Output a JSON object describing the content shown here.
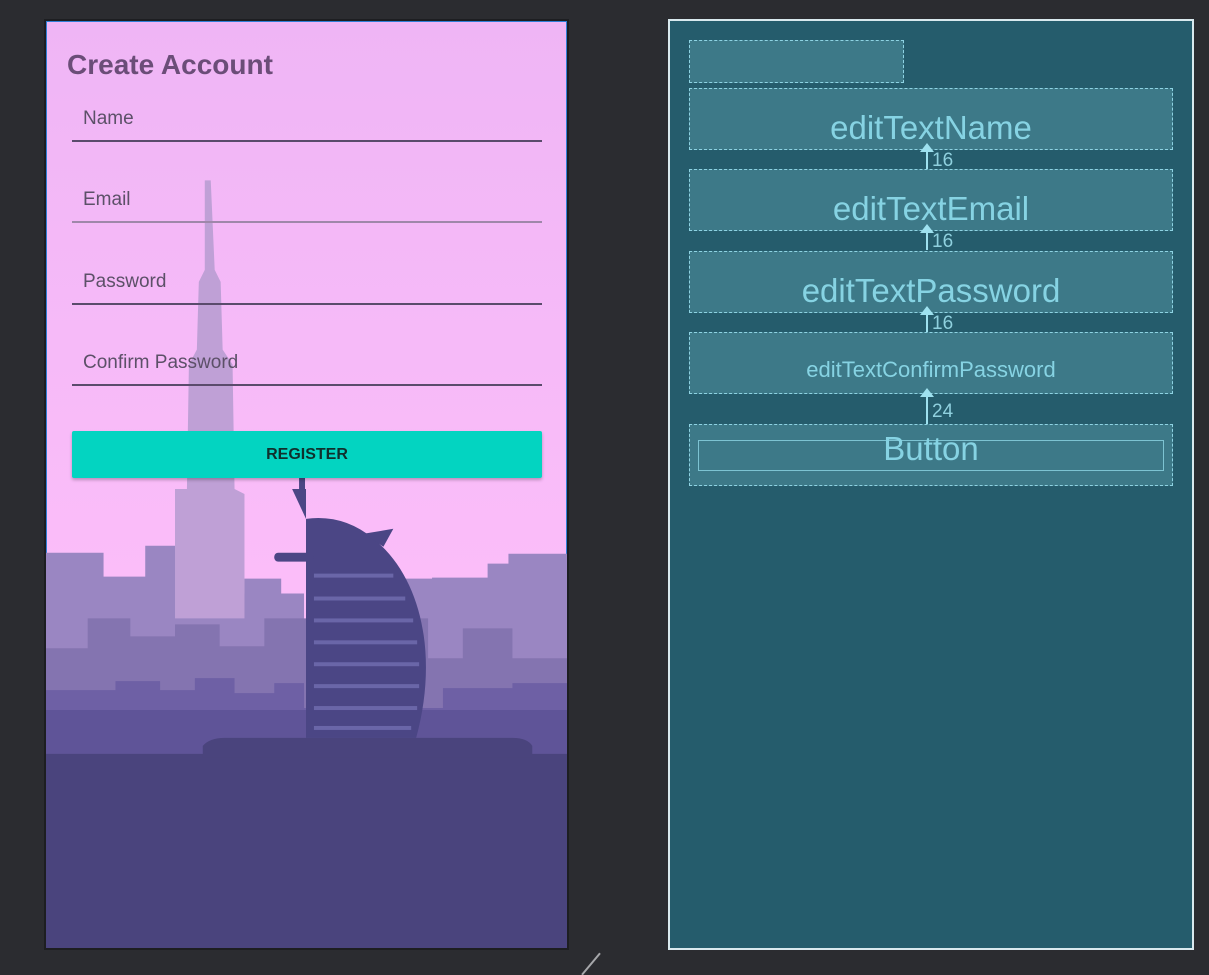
{
  "design": {
    "title": "Create Account",
    "fields": {
      "name_placeholder": "Name",
      "email_placeholder": "Email",
      "password_placeholder": "Password",
      "confirm_password_placeholder": "Confirm Password"
    },
    "register_label": "REGISTER",
    "colors": {
      "background": "#f5b9f7",
      "button": "#03d4c1",
      "title": "#6b4d78",
      "skyline_dark": "#4a447d"
    }
  },
  "blueprint": {
    "items": [
      {
        "label": "editTextName"
      },
      {
        "label": "editTextEmail"
      },
      {
        "label": "editTextPassword"
      },
      {
        "label": "editTextConfirmPassword"
      },
      {
        "label": "Button"
      }
    ],
    "margins": [
      "16",
      "16",
      "16",
      "24"
    ],
    "colors": {
      "background": "#255c6c",
      "box": "#3d7988",
      "text": "#86d3e3"
    }
  }
}
